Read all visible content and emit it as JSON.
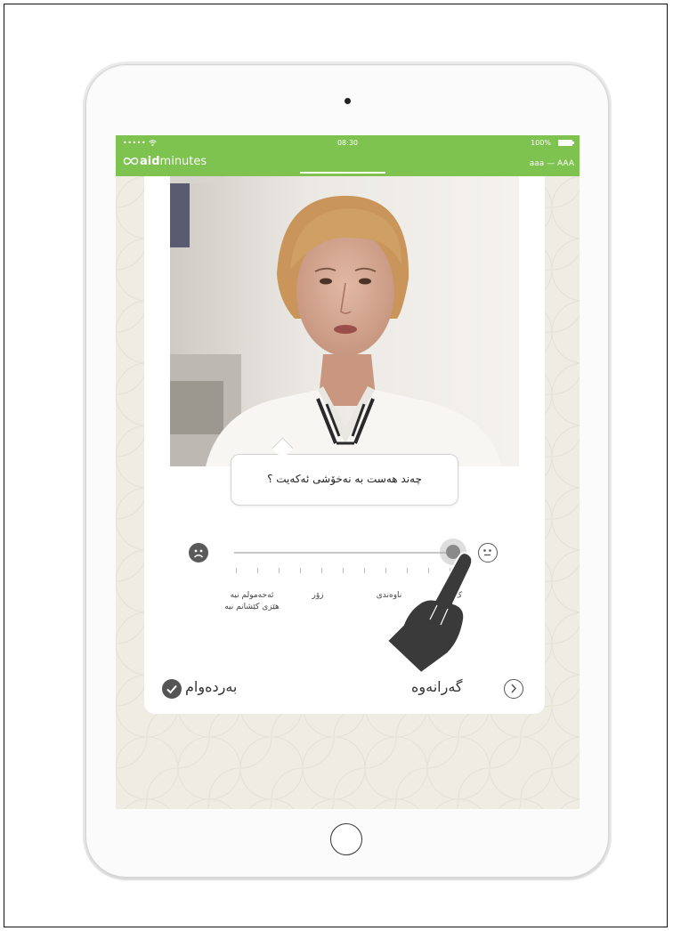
{
  "status_bar": {
    "signal": "••••• ",
    "time": "08:30",
    "battery": "100%"
  },
  "header": {
    "brand_bold": "aid",
    "brand_light": "minutes",
    "user": "aaa — AAA",
    "accent_color": "#7ec24f"
  },
  "question": {
    "text": "چەند هەست بە نەخۆشی ئەکەیت ؟"
  },
  "pain_scale": {
    "value": 1.0,
    "labels": [
      {
        "line1": "ئەحەمولم نیە",
        "line2": "هێزی کێشانم نیە"
      },
      {
        "line1": "زۆر",
        "line2": ""
      },
      {
        "line1": "ناوەندی",
        "line2": ""
      },
      {
        "line1": "ک",
        "line2": ""
      }
    ]
  },
  "actions": {
    "continue_label": "بەردەوام",
    "back_label": "گەرانەوە"
  },
  "icons": {
    "sad": "sad-face-icon",
    "neutral": "neutral-face-icon",
    "check": "check-icon",
    "chevron": "chevron-right-icon",
    "hand": "pointing-hand-icon",
    "logo": "infinity-logo-icon"
  }
}
